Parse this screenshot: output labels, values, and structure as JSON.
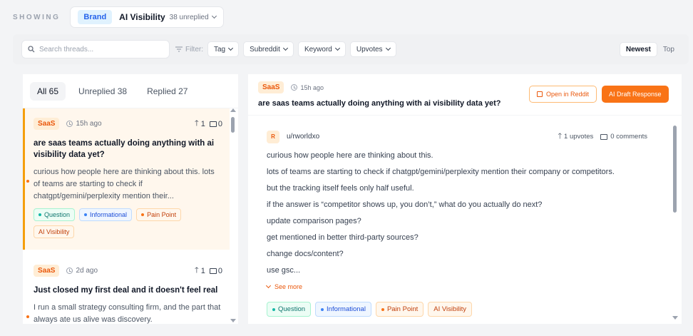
{
  "header": {
    "showing_label": "SHOWING",
    "brand_pill": "Brand",
    "scope_title": "AI Visibility",
    "scope_count": "38 unreplied"
  },
  "filters": {
    "search_placeholder": "Search threads...",
    "filter_label": "Filter:",
    "dropdowns": [
      "Tag",
      "Subreddit",
      "Keyword",
      "Upvotes"
    ],
    "sort": {
      "newest": "Newest",
      "top": "Top"
    }
  },
  "tabs": {
    "all": "All 65",
    "unreplied": "Unreplied 38",
    "replied": "Replied 27"
  },
  "threads": [
    {
      "subreddit": "SaaS",
      "time": "15h ago",
      "upvotes": "1",
      "comments": "0",
      "title": "are saas teams actually doing anything with ai visibility data yet?",
      "excerpt": "curious how people here are thinking about this. lots of teams are starting to check if chatgpt/gemini/perplexity mention their...",
      "tags": [
        "Question",
        "Informational",
        "Pain Point",
        "AI Visibility"
      ]
    },
    {
      "subreddit": "SaaS",
      "time": "2d ago",
      "upvotes": "1",
      "comments": "0",
      "title": "Just closed my first deal and it doesn't feel real",
      "excerpt": "I run a small strategy consulting firm, and the part that always ate us alive was discovery."
    }
  ],
  "detail": {
    "subreddit": "SaaS",
    "time": "15h ago",
    "title": "are saas teams actually doing anything with ai visibility data yet?",
    "open_button": "Open in Reddit",
    "draft_button": "AI Draft Response",
    "avatar_letter": "R",
    "author": "u/rworldxo",
    "upvotes": "1 upvotes",
    "comments": "0 comments",
    "lines": [
      "curious how people here are thinking about this.",
      "lots of teams are starting to check if chatgpt/gemini/perplexity mention their company or competitors.",
      "but the tracking itself feels only half useful.",
      "if the answer is “competitor shows up, you don’t,” what do you actually do next?",
      "update comparison pages?",
      "get mentioned in better third-party sources?",
      "change docs/content?",
      "use gsc..."
    ],
    "see_more": "See more",
    "tags": [
      "Question",
      "Informational",
      "Pain Point",
      "AI Visibility"
    ]
  }
}
